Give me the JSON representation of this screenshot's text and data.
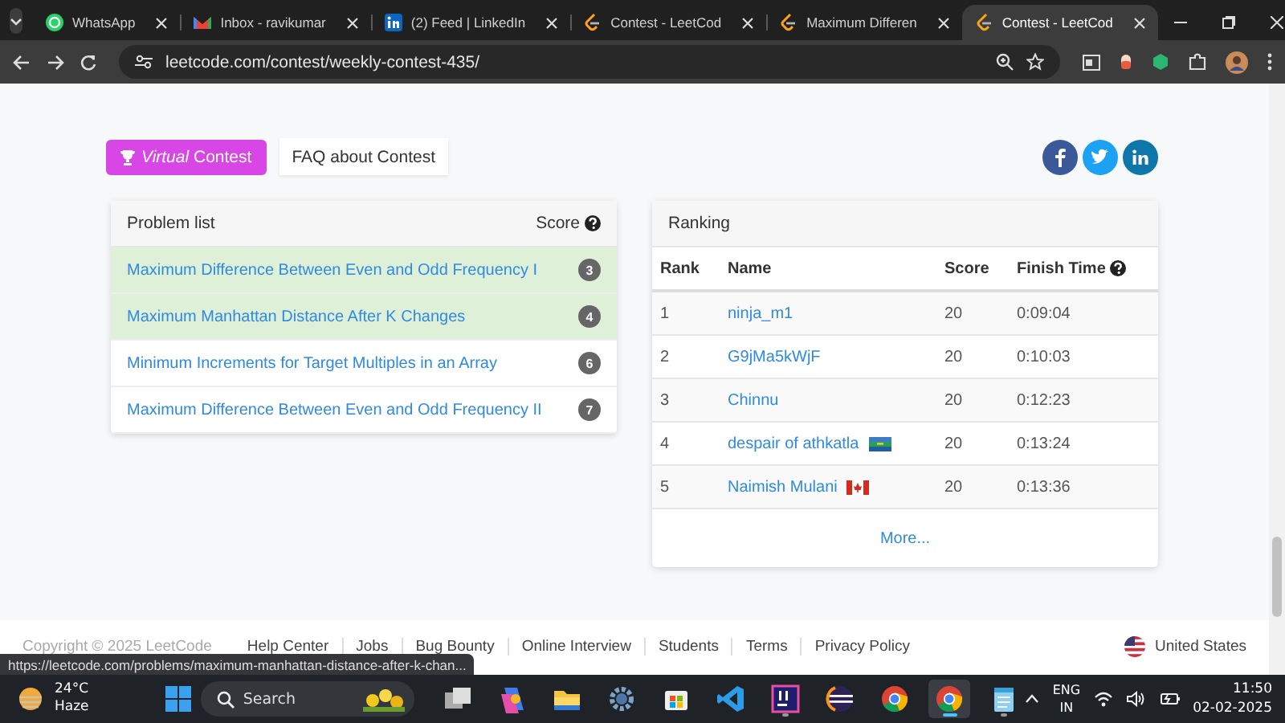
{
  "browser": {
    "tabs": [
      {
        "title": "WhatsApp",
        "kind": "chat",
        "selected": false
      },
      {
        "title": "Inbox - ravikumar",
        "kind": "mail",
        "selected": false
      },
      {
        "title": "(2) Feed | LinkedIn",
        "kind": "social",
        "selected": false
      },
      {
        "title": "Contest - LeetCod",
        "kind": "code",
        "selected": false
      },
      {
        "title": "Maximum Differen",
        "kind": "code",
        "selected": false
      },
      {
        "title": "Contest - LeetCod",
        "kind": "code",
        "selected": true
      }
    ],
    "address": "leetcode.com/contest/weekly-contest-435/"
  },
  "actions": {
    "virtual_contest": "*Virtual* Contest",
    "faq": "FAQ about Contest"
  },
  "problem_list": {
    "title": "Problem list",
    "score_heading": "Score",
    "problems": [
      {
        "title": "Maximum Difference Between Even and Odd Frequency I",
        "score": "3",
        "solved": true
      },
      {
        "title": "Maximum Manhattan Distance After K Changes",
        "score": "4",
        "solved": true
      },
      {
        "title": "Minimum Increments for Target Multiples in an Array",
        "score": "6",
        "solved": false
      },
      {
        "title": "Maximum Difference Between Even and Odd Frequency II",
        "score": "7",
        "solved": false
      }
    ]
  },
  "ranking": {
    "title": "Ranking",
    "columns": [
      "Rank",
      "Name",
      "Score",
      "Finish Time"
    ],
    "rows": [
      {
        "rank": "1",
        "name": "ninja_m1",
        "score": "20",
        "finish_time": "0:09:04",
        "kind": "plain"
      },
      {
        "rank": "2",
        "name": "G9jMa5kWjF",
        "score": "20",
        "finish_time": "0:10:03",
        "kind": "plain"
      },
      {
        "rank": "3",
        "name": "Chinnu",
        "score": "20",
        "finish_time": "0:12:23",
        "kind": "plain"
      },
      {
        "rank": "4",
        "name": "despair of athkatla",
        "score": "20",
        "finish_time": "0:13:24",
        "kind": "striped"
      },
      {
        "rank": "5",
        "name": "Naimish Mulani",
        "score": "20",
        "finish_time": "0:13:36",
        "kind": "maple"
      }
    ],
    "more": "More..."
  },
  "footer": {
    "copyright": "Copyright © 2025 LeetCode",
    "links": [
      "Help Center",
      "Jobs",
      "Bug Bounty",
      "Online Interview",
      "Students",
      "Terms",
      "Privacy Policy"
    ],
    "region": "United States"
  },
  "status_url": "https://leetcode.com/problems/maximum-manhattan-distance-after-k-chan...",
  "taskbar": {
    "weather": {
      "temperature": "24°C",
      "condition": "Haze"
    },
    "search": {
      "placeholder": "Search"
    },
    "apps": [
      {
        "kind": "taskview",
        "active": false
      },
      {
        "kind": "copilot",
        "active": false
      },
      {
        "kind": "folder",
        "active": false
      },
      {
        "kind": "gear",
        "active": false
      },
      {
        "kind": "store",
        "active": false
      },
      {
        "kind": "code",
        "active": false
      },
      {
        "kind": "ide",
        "active": false
      },
      {
        "kind": "eclipse",
        "active": false
      },
      {
        "kind": "chrome",
        "active": false
      },
      {
        "kind": "chrome",
        "active": true
      },
      {
        "kind": "notepad",
        "active": false
      }
    ],
    "language": "ENG",
    "region": "IN",
    "time": "11:50",
    "date": "02-02-2025"
  }
}
